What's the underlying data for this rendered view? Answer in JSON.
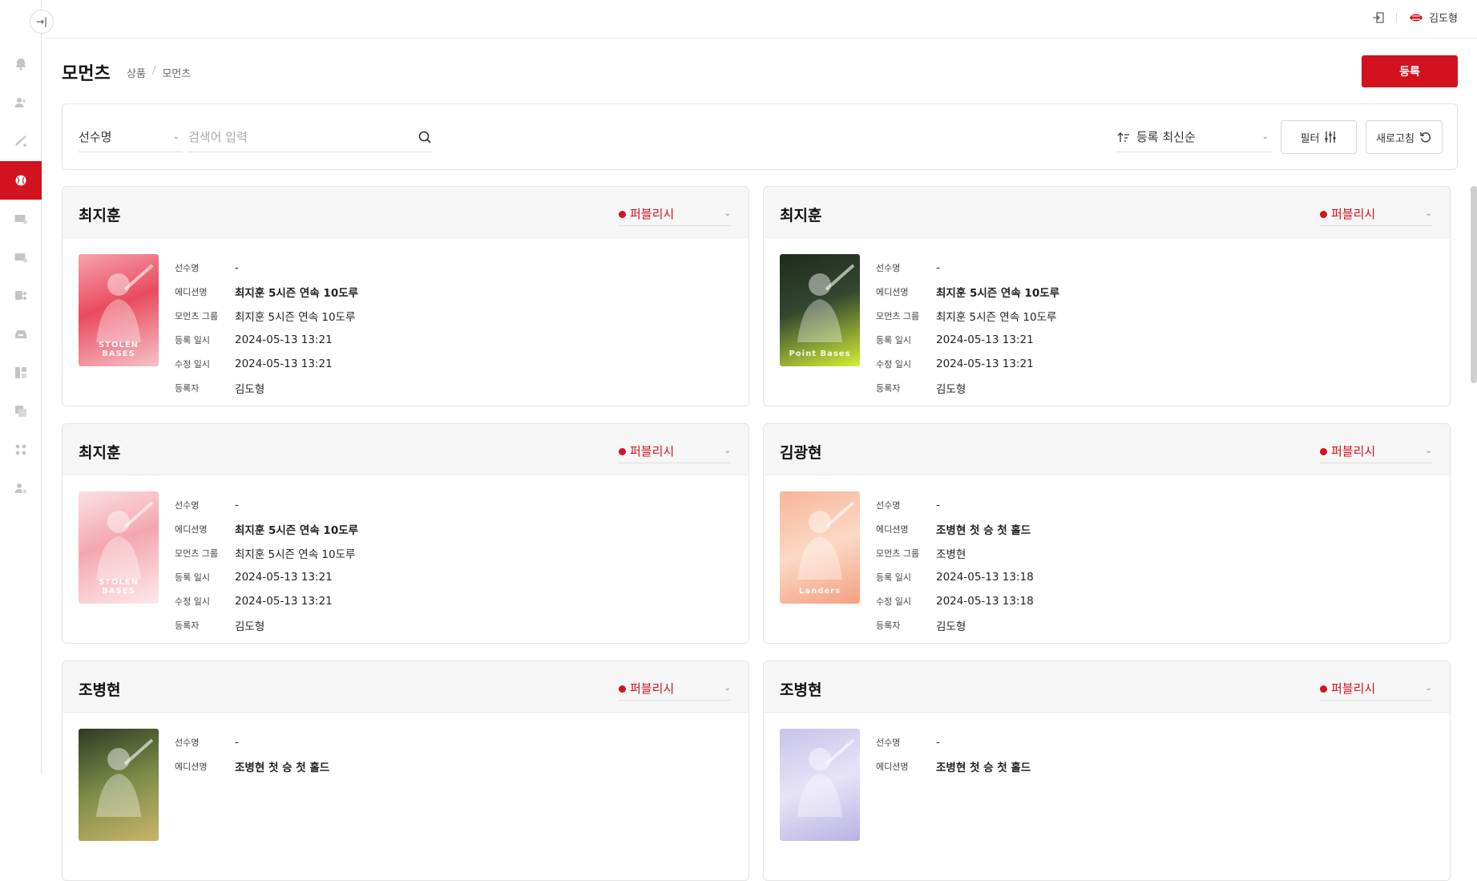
{
  "topbar": {
    "user_name": "김도형"
  },
  "header": {
    "title": "모먼츠",
    "breadcrumb": [
      "상품",
      "모먼츠"
    ],
    "register_label": "등록"
  },
  "search": {
    "field_select": "선수명",
    "placeholder": "검색어 입력",
    "sort_label": "등록 최신순",
    "filter_label": "필터",
    "refresh_label": "새로고침"
  },
  "labels": {
    "player": "선수명",
    "edition": "에디션명",
    "group": "모먼츠 그룹",
    "created": "등록 일시",
    "updated": "수정 일시",
    "author": "등록자"
  },
  "colors": {
    "accent": "#d2121e"
  },
  "cards": [
    {
      "name": "최지훈",
      "status": "퍼블리시",
      "player": "-",
      "edition": "최지훈 5시즌 연속 10도루",
      "group": "최지훈 5시즌 연속 10도루",
      "created": "2024-05-13 13:21",
      "updated": "2024-05-13 13:21",
      "author": "김도형",
      "thumb_text": "STOLEN BASES",
      "thumb_icon": "player-card-pink-image"
    },
    {
      "name": "최지훈",
      "status": "퍼블리시",
      "player": "-",
      "edition": "최지훈 5시즌 연속 10도루",
      "group": "최지훈 5시즌 연속 10도루",
      "created": "2024-05-13 13:21",
      "updated": "2024-05-13 13:21",
      "author": "김도형",
      "thumb_text": "Point Bases",
      "thumb_icon": "player-card-dark-image"
    },
    {
      "name": "최지훈",
      "status": "퍼블리시",
      "player": "-",
      "edition": "최지훈 5시즌 연속 10도루",
      "group": "최지훈 5시즌 연속 10도루",
      "created": "2024-05-13 13:21",
      "updated": "2024-05-13 13:21",
      "author": "김도형",
      "thumb_text": "STOLEN BASES",
      "thumb_icon": "player-card-light-pink-image"
    },
    {
      "name": "김광현",
      "status": "퍼블리시",
      "player": "-",
      "edition": "조병현 첫 승 첫 홀드",
      "group": "조병현",
      "created": "2024-05-13 13:18",
      "updated": "2024-05-13 13:18",
      "author": "김도형",
      "thumb_text": "Landers",
      "thumb_icon": "player-card-peach-image"
    },
    {
      "name": "조병현",
      "status": "퍼블리시",
      "player": "-",
      "edition": "조병현 첫 승 첫 홀드",
      "thumb_icon": "player-card-green-image"
    },
    {
      "name": "조병현",
      "status": "퍼블리시",
      "player": "-",
      "edition": "조병현 첫 승 첫 홀드",
      "thumb_icon": "player-card-lavender-image"
    }
  ]
}
